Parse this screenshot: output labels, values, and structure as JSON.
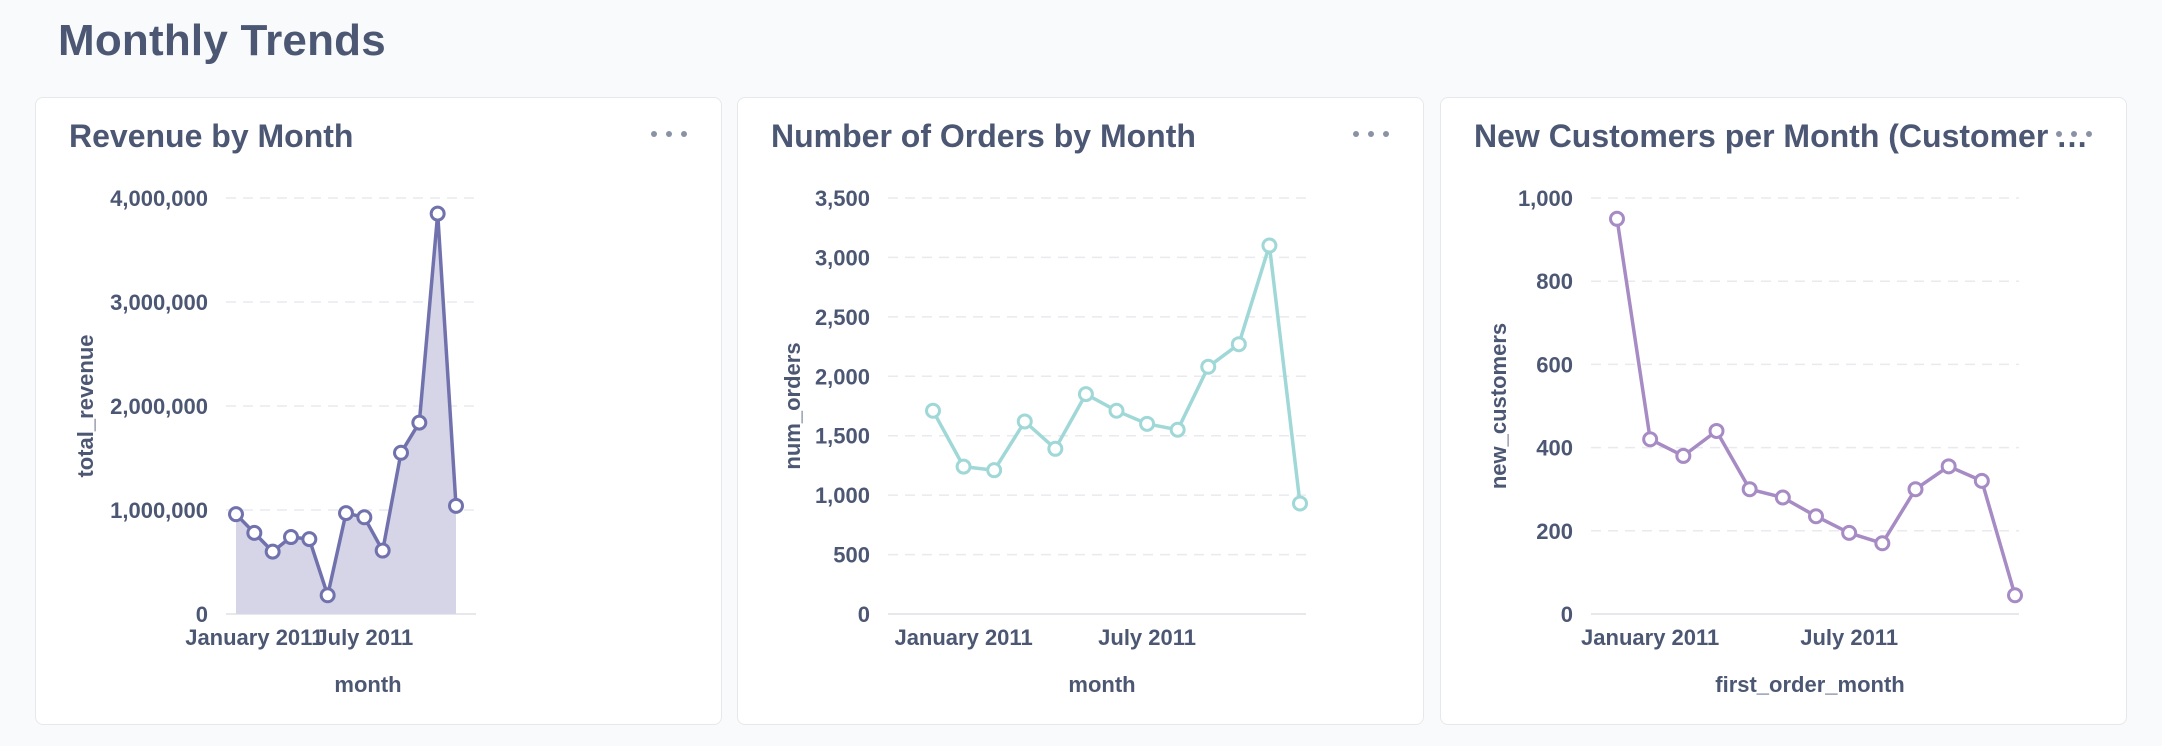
{
  "section": {
    "title": "Monthly Trends"
  },
  "cards": [
    {
      "title": "Revenue by Month",
      "menu_icon": "ellipsis-icon"
    },
    {
      "title": "Number of Orders by Month",
      "menu_icon": "ellipsis-icon"
    },
    {
      "title": "New Customers per Month (Customer Acquisition)",
      "menu_icon": "ellipsis-icon"
    }
  ],
  "chart_data": [
    {
      "type": "area",
      "title": "Revenue by Month",
      "xlabel": "month",
      "ylabel": "total_revenue",
      "color": "#7172ad",
      "fill_color": "#d5d5e7",
      "ylim": [
        0,
        4000000
      ],
      "yticks": [
        0,
        1000000,
        2000000,
        3000000,
        4000000
      ],
      "ytick_labels": [
        "0",
        "1,000,000",
        "2,000,000",
        "3,000,000",
        "4,000,000"
      ],
      "xtick_labels": [
        "January 2011",
        "July 2011"
      ],
      "xtick_positions": [
        0,
        6
      ],
      "grid": true,
      "x": [
        "2011-01",
        "2011-02",
        "2011-03",
        "2011-04",
        "2011-05",
        "2011-06",
        "2011-07",
        "2011-08",
        "2011-09",
        "2011-10",
        "2011-11",
        "2011-12"
      ],
      "values": [
        960000,
        780000,
        600000,
        740000,
        720000,
        180000,
        970000,
        930000,
        610000,
        1550000,
        1840000,
        3850000,
        1040000
      ],
      "x_full": [
        "2010-12",
        "2011-01",
        "2011-02",
        "2011-03",
        "2011-04",
        "2011-05",
        "2011-06",
        "2011-07",
        "2011-08",
        "2011-09",
        "2011-10",
        "2011-11",
        "2011-12"
      ]
    },
    {
      "type": "line",
      "title": "Number of Orders by Month",
      "xlabel": "month",
      "ylabel": "num_orders",
      "color": "#a0d8d8",
      "ylim": [
        0,
        3500
      ],
      "yticks": [
        0,
        500,
        1000,
        1500,
        2000,
        2500,
        3000,
        3500
      ],
      "ytick_labels": [
        "0",
        "500",
        "1,000",
        "1,500",
        "2,000",
        "2,500",
        "3,000",
        "3,500"
      ],
      "xtick_labels": [
        "January 2011",
        "July 2011"
      ],
      "xtick_positions": [
        0,
        6
      ],
      "grid": true,
      "x_full": [
        "2010-12",
        "2011-01",
        "2011-02",
        "2011-03",
        "2011-04",
        "2011-05",
        "2011-06",
        "2011-07",
        "2011-08",
        "2011-09",
        "2011-10",
        "2011-11",
        "2011-12"
      ],
      "values": [
        1710,
        1240,
        1210,
        1620,
        1390,
        1850,
        1710,
        1600,
        1550,
        2080,
        2270,
        3100,
        930
      ]
    },
    {
      "type": "line",
      "title": "New Customers per Month (Customer Acquisition)",
      "xlabel": "first_order_month",
      "ylabel": "new_customers",
      "color": "#a68bc4",
      "ylim": [
        0,
        1000
      ],
      "yticks": [
        0,
        200,
        400,
        600,
        800,
        1000
      ],
      "ytick_labels": [
        "0",
        "200",
        "400",
        "600",
        "800",
        "1,000"
      ],
      "xtick_labels": [
        "January 2011",
        "July 2011"
      ],
      "xtick_positions": [
        0,
        6
      ],
      "grid": true,
      "x_full": [
        "2010-12",
        "2011-01",
        "2011-02",
        "2011-03",
        "2011-04",
        "2011-05",
        "2011-06",
        "2011-07",
        "2011-08",
        "2011-09",
        "2011-10",
        "2011-11",
        "2011-12"
      ],
      "values": [
        950,
        420,
        380,
        440,
        300,
        280,
        235,
        195,
        170,
        300,
        355,
        320,
        45
      ]
    }
  ]
}
